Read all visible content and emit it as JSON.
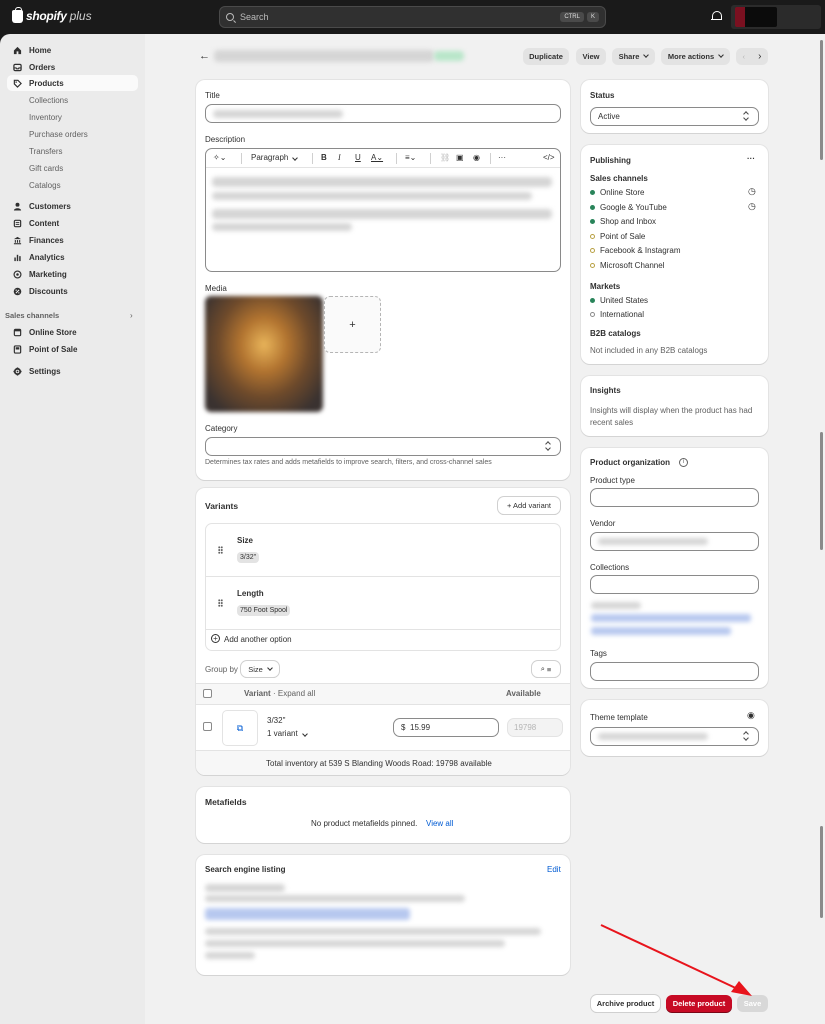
{
  "topbar": {
    "logo_text": "shopify",
    "logo_plus": "plus",
    "search_placeholder": "Search",
    "kbd_ctrl": "CTRL",
    "kbd_k": "K"
  },
  "sidebar": {
    "home": "Home",
    "orders": "Orders",
    "products": "Products",
    "collections": "Collections",
    "inventory": "Inventory",
    "purchase_orders": "Purchase orders",
    "transfers": "Transfers",
    "gift_cards": "Gift cards",
    "catalogs": "Catalogs",
    "customers": "Customers",
    "content": "Content",
    "finances": "Finances",
    "analytics": "Analytics",
    "marketing": "Marketing",
    "discounts": "Discounts",
    "sales_channels": "Sales channels",
    "online_store": "Online Store",
    "point_of_sale": "Point of Sale",
    "settings": "Settings"
  },
  "header": {
    "duplicate": "Duplicate",
    "view": "View",
    "share": "Share",
    "more_actions": "More actions"
  },
  "product": {
    "title_label": "Title",
    "description_label": "Description",
    "paragraph": "Paragraph",
    "media_label": "Media",
    "add_media": "+",
    "category_label": "Category",
    "category_helper": "Determines tax rates and adds metafields to improve search, filters, and cross-channel sales"
  },
  "variants": {
    "title": "Variants",
    "add_variant": "+ Add variant",
    "options": [
      {
        "name": "Size",
        "value": "3/32\""
      },
      {
        "name": "Length",
        "value": "750 Foot Spool"
      }
    ],
    "add_option": "Add another option",
    "group_by": "Group by",
    "group_by_value": "Size",
    "col_variant": "Variant",
    "col_expand": "· Expand all",
    "col_available": "Available",
    "row_name": "3/32\"",
    "row_sub": "1 variant",
    "row_price_symbol": "$",
    "row_price": "15.99",
    "row_available": "19798",
    "total_inventory": "Total inventory at 539 S Blanding Woods Road: 19798 available"
  },
  "metafields": {
    "title": "Metafields",
    "empty": "No product metafields pinned.",
    "view_all": "View all"
  },
  "seo": {
    "title": "Search engine listing",
    "edit": "Edit"
  },
  "status": {
    "title": "Status",
    "value": "Active"
  },
  "publishing": {
    "title": "Publishing",
    "more": "···",
    "sales_channels_label": "Sales channels",
    "channels": [
      {
        "name": "Online Store",
        "active": true
      },
      {
        "name": "Google & YouTube",
        "active": true
      },
      {
        "name": "Shop and Inbox",
        "active": true
      },
      {
        "name": "Point of Sale",
        "active": false
      },
      {
        "name": "Facebook & Instagram",
        "active": false
      },
      {
        "name": "Microsoft Channel",
        "active": false
      }
    ],
    "markets_label": "Markets",
    "markets": [
      {
        "name": "United States",
        "active": true
      },
      {
        "name": "International",
        "active": false
      }
    ],
    "b2b_label": "B2B catalogs",
    "b2b_value": "Not included in any B2B catalogs"
  },
  "insights": {
    "title": "Insights",
    "text": "Insights will display when the product has had recent sales"
  },
  "organization": {
    "title": "Product organization",
    "product_type": "Product type",
    "vendor": "Vendor",
    "collections": "Collections",
    "tags": "Tags"
  },
  "theme": {
    "title": "Theme template"
  },
  "footer": {
    "archive": "Archive product",
    "delete": "Delete product",
    "save": "Save"
  },
  "colors": {
    "accent_green": "#29845a",
    "delete_red": "#c70a24",
    "annotation_arrow": "#e8141c",
    "link_blue": "#005bd3"
  }
}
